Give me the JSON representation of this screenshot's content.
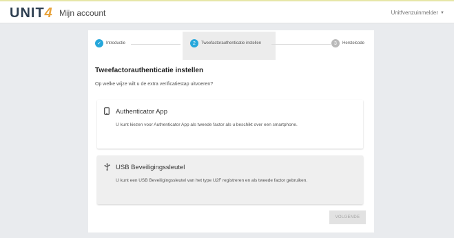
{
  "header": {
    "logo_main": "UNIT",
    "logo_four": "4",
    "app_title": "Mijn account",
    "user": "Unitfvenzuinmelder"
  },
  "stepper": {
    "steps": [
      {
        "label": "Introductie",
        "badge": "✓"
      },
      {
        "label": "Tweefactorauthenticatie instellen",
        "badge": "2"
      },
      {
        "label": "Herstelcode",
        "badge": "3"
      }
    ]
  },
  "main": {
    "heading": "Tweefactorauthenticatie instellen",
    "question": "Op welke wijze wilt u de extra verificatiestap uitvoeren?",
    "options": [
      {
        "icon": "smartphone-icon",
        "title": "Authenticator App",
        "description": "U kunt kiezen voor Authenticator App als tweede factor als u beschikt over een smartphone."
      },
      {
        "icon": "usb-icon",
        "title": "USB Beveiligingssleutel",
        "description": "U kunt een USB Beveiligingssleutel van het type U2F registreren en als tweede factor gebruiken."
      }
    ],
    "next_label": "VOLGENDE"
  }
}
